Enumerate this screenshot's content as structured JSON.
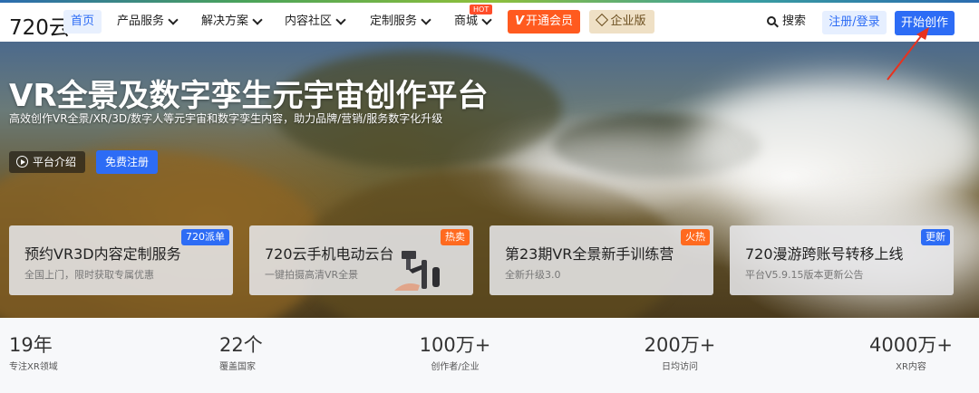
{
  "nav": {
    "logo": "720云",
    "home": "首页",
    "items": [
      {
        "label": "产品服务"
      },
      {
        "label": "解决方案"
      },
      {
        "label": "内容社区"
      },
      {
        "label": "定制服务"
      },
      {
        "label": "商城"
      }
    ],
    "mall_badge": "HOT",
    "vip_mark": "V",
    "vip": "开通会员",
    "enterprise": "企业版",
    "search": "搜索",
    "login": "注册/登录",
    "create": "开始创作"
  },
  "hero": {
    "title": "VR全景及数字孪生元宇宙创作平台",
    "subtitle": "高效创作VR全景/XR/3D/数字人等元宇宙和数字孪生内容，助力品牌/营销/服务数字化升级",
    "intro_button": "平台介绍",
    "register_button": "免费注册"
  },
  "cards": [
    {
      "title": "预约VR3D内容定制服务",
      "desc": "全国上门，限时获取专属优惠",
      "badge": "720派单",
      "badge_color": "#2d6cf5"
    },
    {
      "title": "720云手机电动云台",
      "desc": "一键拍摄高清VR全景",
      "badge": "热卖",
      "badge_color": "#ff6a1f"
    },
    {
      "title": "第23期VR全景新手训练营",
      "desc": "全新升级3.0",
      "badge": "火热",
      "badge_color": "#ff6a1f"
    },
    {
      "title": "720漫游跨账号转移上线",
      "desc": "平台V5.9.15版本更新公告",
      "badge": "更新",
      "badge_color": "#2d6cf5"
    }
  ],
  "stats": [
    {
      "number": "19年",
      "label": "专注XR领域"
    },
    {
      "number": "22个",
      "label": "覆盖国家"
    },
    {
      "number": "100万+",
      "label": "创作者/企业"
    },
    {
      "number": "200万+",
      "label": "日均访问"
    },
    {
      "number": "4000万+",
      "label": "XR内容"
    }
  ],
  "colors": {
    "primary": "#2d6cf5",
    "vip": "#ff5a1f",
    "annotation_arrow": "#e8321e"
  }
}
